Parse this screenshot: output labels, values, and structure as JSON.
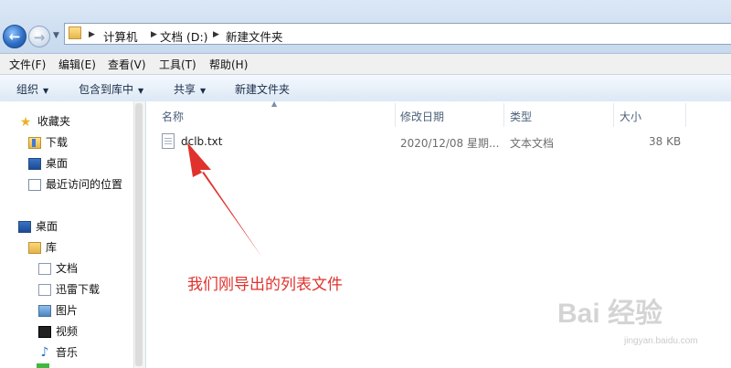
{
  "address": {
    "crumbs": [
      "计算机",
      "文档 (D:)",
      "新建文件夹"
    ]
  },
  "menu": [
    "文件(F)",
    "编辑(E)",
    "查看(V)",
    "工具(T)",
    "帮助(H)"
  ],
  "toolbar": {
    "organize": "组织",
    "include_library": "包含到库中",
    "share": "共享",
    "new_folder": "新建文件夹"
  },
  "nav": {
    "favorites": "收藏夹",
    "fav_items": [
      "下载",
      "桌面",
      "最近访问的位置"
    ],
    "desktop": "桌面",
    "libraries": "库",
    "lib_items": [
      "文档",
      "迅雷下载",
      "图片",
      "视频",
      "音乐"
    ]
  },
  "columns": {
    "name": "名称",
    "modified": "修改日期",
    "type": "类型",
    "size": "大小"
  },
  "files": [
    {
      "name": "dclb.txt",
      "modified": "2020/12/08 星期...",
      "type": "文本文档",
      "size": "38 KB"
    }
  ],
  "annotation": "我们刚导出的列表文件",
  "watermark": "Bai 经验",
  "watermark_sub": "jingyan.baidu.com",
  "colors": {
    "accent": "#2e6fc4",
    "annotation": "#e0322d"
  }
}
